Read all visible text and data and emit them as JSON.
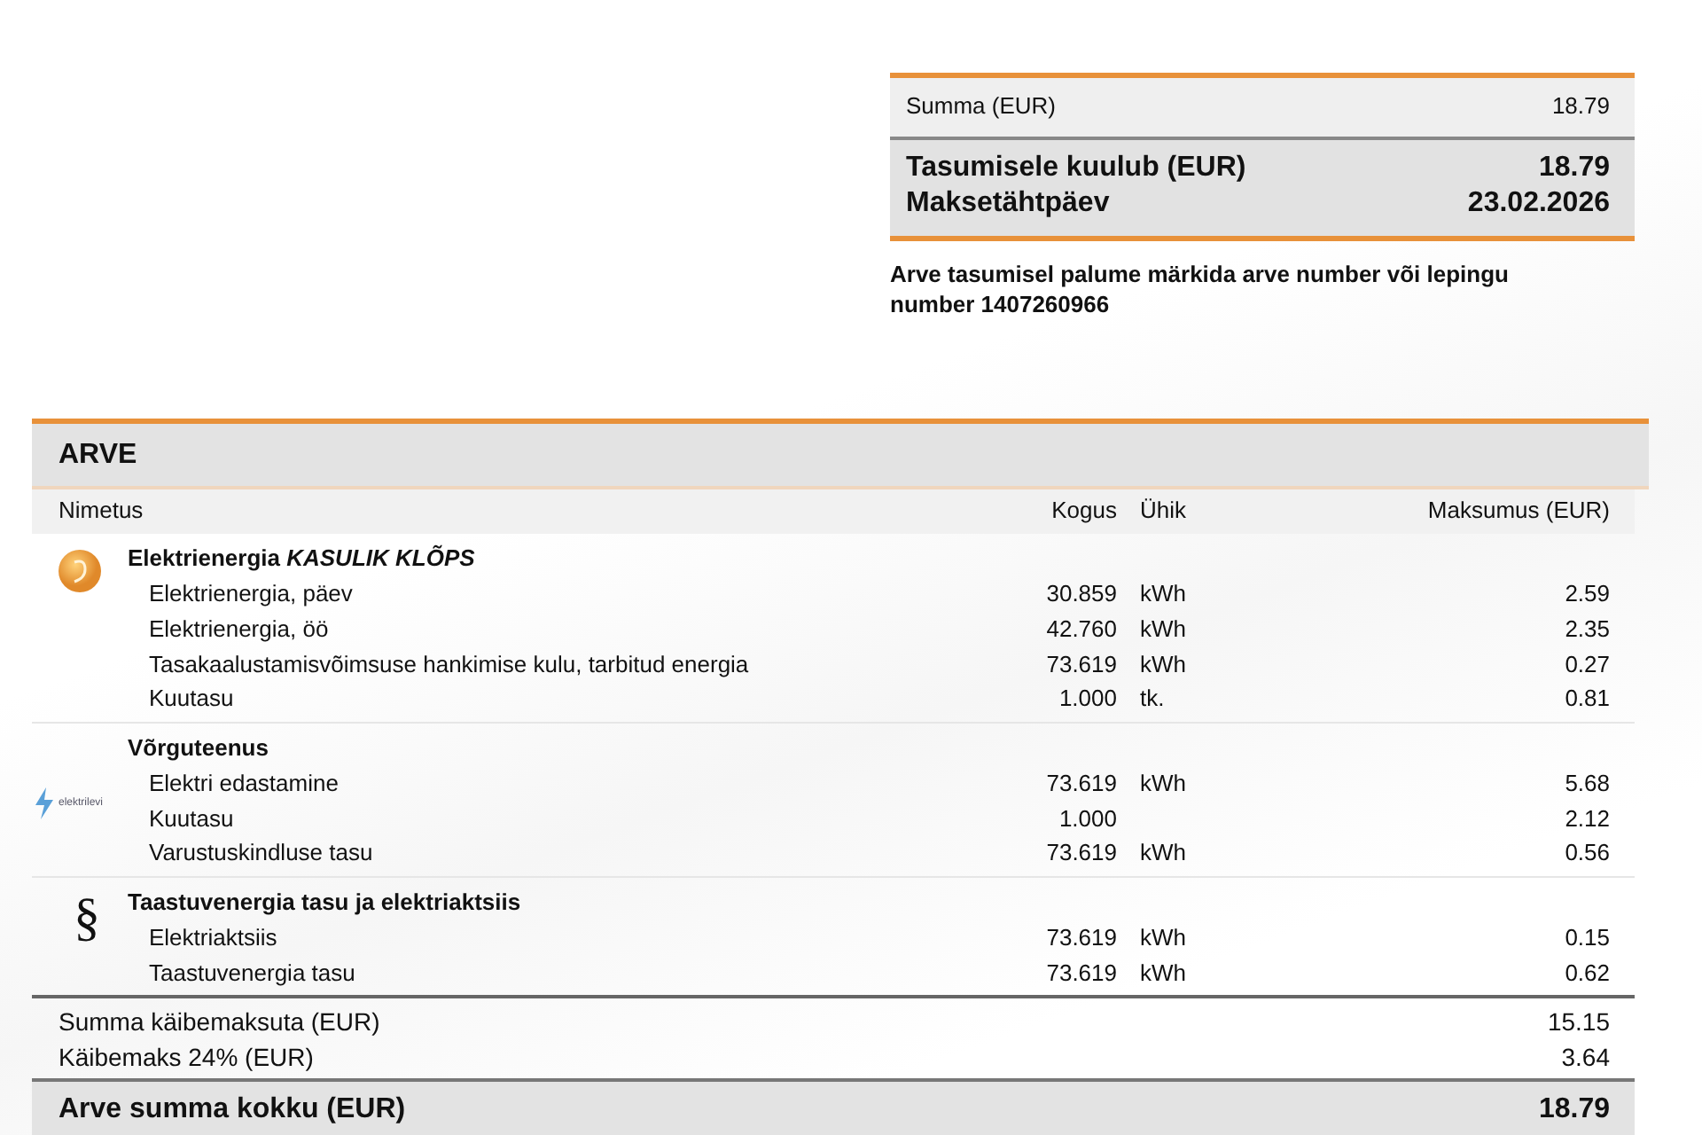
{
  "summary": {
    "rows": [
      {
        "label": "Summa (EUR)",
        "value": "18.79"
      }
    ],
    "due": [
      {
        "label": "Tasumisele kuulub (EUR)",
        "value": "18.79"
      },
      {
        "label": "Maksetähtpäev",
        "value": "23.02.2026"
      }
    ],
    "note": "Arve tasumisel palume märkida arve number või lepingu number 1407260966"
  },
  "invoice": {
    "title": "ARVE",
    "columns": [
      "Nimetus",
      "Kogus",
      "Ühik",
      "Maksumus (EUR)"
    ],
    "groups": [
      {
        "kind": "sun",
        "title": "Elektrienergia *KASULIK KLÕPS*",
        "rows": [
          [
            "Elektrienergia, päev",
            "30.859",
            "kWh",
            "2.59"
          ],
          [
            "Elektrienergia, öö",
            "42.760",
            "kWh",
            "2.35"
          ],
          [
            "Tasakaalustamisvõimsuse hankimise kulu, tarbitud energia",
            "73.619",
            "kWh",
            "0.27"
          ],
          [
            "Kuutasu",
            "1.000",
            "tk.",
            "0.81"
          ]
        ]
      },
      {
        "kind": "lightning",
        "logo_text": "elektrilevi",
        "title": "Võrguteenus",
        "rows": [
          [
            "Elektri edastamine",
            "73.619",
            "kWh",
            "5.68"
          ],
          [
            "Kuutasu",
            "1.000",
            "",
            "2.12"
          ],
          [
            "Varustuskindluse tasu",
            "73.619",
            "kWh",
            "0.56"
          ]
        ]
      },
      {
        "kind": "symbol",
        "symbol": "§",
        "title": "Taastuvenergia tasu ja elektriaktsiis",
        "rows": [
          [
            "Elektriaktsiis",
            "73.619",
            "kWh",
            "0.15"
          ],
          [
            "Taastuvenergia tasu",
            "73.619",
            "kWh",
            "0.62"
          ]
        ]
      }
    ],
    "subtotals": [
      {
        "label": "Summa käibemaksuta (EUR)",
        "value": "15.15"
      },
      {
        "label": "Käibemaks 24% (EUR)",
        "value": "3.64"
      }
    ],
    "total": {
      "label": "Arve summa kokku (EUR)",
      "value": "18.79"
    }
  }
}
